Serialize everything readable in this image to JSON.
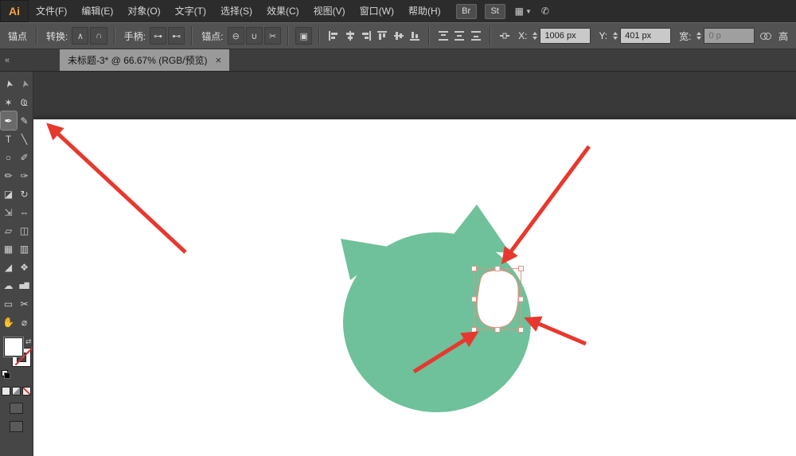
{
  "colors": {
    "menubar_bg": "#2c2c2c",
    "controlbar_bg": "#525252",
    "tabbar_bg": "#3d3d3d",
    "tab_active_bg": "#9a9a9a",
    "toolbar_bg": "#464646",
    "pasteboard_bg": "#393939",
    "artboard_bg": "#ffffff",
    "field_bg": "#c9c9c9",
    "text_light": "#d6d6d6",
    "logo_orange": "#f9a43f",
    "shape_green": "#6ec19b",
    "cutout_stroke": "#e09382",
    "selection_red": "#e09382",
    "arrow_red": "#e8382e"
  },
  "menubar": {
    "logo": "Ai",
    "items": [
      {
        "label": "文件(F)"
      },
      {
        "label": "编辑(E)"
      },
      {
        "label": "对象(O)"
      },
      {
        "label": "文字(T)"
      },
      {
        "label": "选择(S)"
      },
      {
        "label": "效果(C)"
      },
      {
        "label": "视图(V)"
      },
      {
        "label": "窗口(W)"
      },
      {
        "label": "帮助(H)"
      }
    ],
    "bridge_badge": "Br",
    "stock_badge": "St",
    "arrange_icon": "▦",
    "arrange_caret": "▼",
    "share_icon": "✆"
  },
  "controlbar": {
    "context_label": "锚点",
    "convert": {
      "label": "转换:",
      "buttons": [
        {
          "name": "convert-to-corner",
          "glyph": "∧"
        },
        {
          "name": "convert-to-smooth",
          "glyph": "∩"
        }
      ]
    },
    "handles": {
      "label": "手柄:",
      "buttons": [
        {
          "name": "show-handles",
          "glyph": "⊶"
        },
        {
          "name": "hide-handles",
          "glyph": "⊷"
        }
      ]
    },
    "anchors": {
      "label": "锚点:",
      "buttons": [
        {
          "name": "remove-selected-anchors",
          "glyph": "⊖"
        },
        {
          "name": "connect-endpoints",
          "glyph": "∪"
        },
        {
          "name": "cut-path",
          "glyph": "✂"
        }
      ]
    },
    "isolate_glyph": "▣",
    "fields": {
      "x": {
        "label": "X:",
        "value": "1006 px"
      },
      "y": {
        "label": "Y:",
        "value": "401 px"
      },
      "w": {
        "label": "宽:",
        "value": "0 p"
      },
      "h": {
        "label": "高"
      }
    }
  },
  "tabbar": {
    "collapse": "«",
    "tab_title": "未标题-3* @ 66.67% (RGB/预览)",
    "close": "×"
  },
  "toolbar": {
    "swap_icon": "⇄",
    "tools": [
      {
        "name": "selection-tool",
        "glyph": "➤"
      },
      {
        "name": "direct-selection-tool",
        "glyph": "➤"
      },
      {
        "name": "magic-wand-tool",
        "glyph": "✶"
      },
      {
        "name": "lasso-tool",
        "glyph": "Ҩ"
      },
      {
        "name": "pen-tool",
        "glyph": "✒"
      },
      {
        "name": "curvature-tool",
        "glyph": "✎"
      },
      {
        "name": "type-tool",
        "glyph": "T"
      },
      {
        "name": "line-segment-tool",
        "glyph": "╲"
      },
      {
        "name": "ellipse-tool",
        "glyph": "○"
      },
      {
        "name": "paintbrush-tool",
        "glyph": "✐"
      },
      {
        "name": "pencil-tool",
        "glyph": "✏"
      },
      {
        "name": "blob-brush-tool",
        "glyph": "✑"
      },
      {
        "name": "eraser-tool",
        "glyph": "◪"
      },
      {
        "name": "rotate-tool",
        "glyph": "↻"
      },
      {
        "name": "scale-tool",
        "glyph": "⇲"
      },
      {
        "name": "width-tool",
        "glyph": "⇔"
      },
      {
        "name": "free-transform-tool",
        "glyph": "▱"
      },
      {
        "name": "shape-builder-tool",
        "glyph": "◫"
      },
      {
        "name": "mesh-tool",
        "glyph": "▦"
      },
      {
        "name": "gradient-tool",
        "glyph": "▥"
      },
      {
        "name": "eyedropper-tool",
        "glyph": "◢"
      },
      {
        "name": "blend-tool",
        "glyph": "❖"
      },
      {
        "name": "symbol-sprayer-tool",
        "glyph": "☁"
      },
      {
        "name": "column-graph-tool",
        "glyph": "▅▇"
      },
      {
        "name": "artboard-tool",
        "glyph": "▭"
      },
      {
        "name": "slice-tool",
        "glyph": "✂"
      },
      {
        "name": "hand-tool",
        "glyph": "✋"
      },
      {
        "name": "zoom-tool",
        "glyph": "⌀"
      }
    ]
  }
}
